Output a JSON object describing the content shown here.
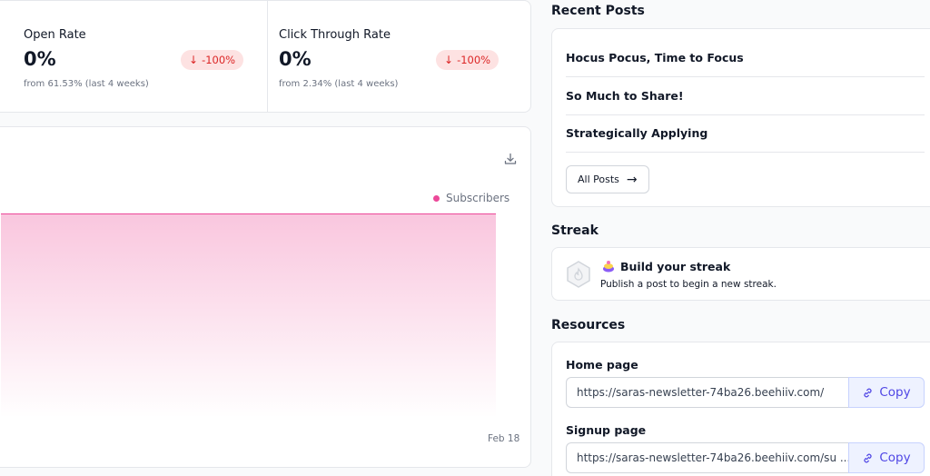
{
  "stats": [
    {
      "label": "Open Rate",
      "value": "0%",
      "change": "-100%",
      "sub": "from 61.53% (last 4 weeks)"
    },
    {
      "label": "Click Through Rate",
      "value": "0%",
      "change": "-100%",
      "sub": "from 2.34% (last 4 weeks)"
    }
  ],
  "chart": {
    "download_icon": "download-icon",
    "accent": "#ec4899"
  },
  "chart_data": {
    "type": "area",
    "series": [
      {
        "name": "Subscribers",
        "values": [
          0
        ]
      }
    ],
    "x": [
      "Feb 18"
    ],
    "x_tick_labels": [
      "Feb 18"
    ],
    "legend": "top-right"
  },
  "recent_posts": {
    "title": "Recent Posts",
    "items": [
      {
        "title": "Hocus Pocus, Time to Focus"
      },
      {
        "title": "So Much to Share!"
      },
      {
        "title": "Strategically Applying"
      }
    ],
    "all_posts_label": "All Posts"
  },
  "streak": {
    "title": "Streak",
    "card_title": "Build your streak",
    "card_sub": "Publish a post to begin a new streak."
  },
  "resources": {
    "title": "Resources",
    "items": [
      {
        "label": "Home page",
        "url": "https://saras-newsletter-74ba26.beehiiv.com/",
        "copy_label": "Copy"
      },
      {
        "label": "Signup page",
        "url": "https://saras-newsletter-74ba26.beehiiv.com/su ...",
        "copy_label": "Copy"
      }
    ]
  }
}
